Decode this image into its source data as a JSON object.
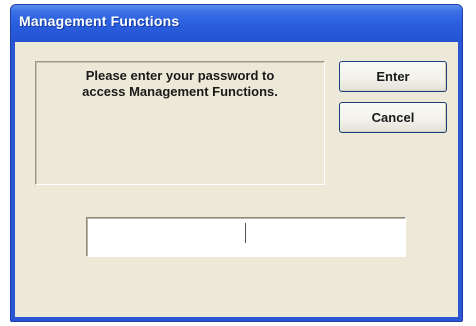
{
  "window": {
    "title": "Management Functions"
  },
  "message": {
    "text": "Please enter your password to\naccess Management Functions."
  },
  "buttons": {
    "enter_label": "Enter",
    "cancel_label": "Cancel"
  },
  "password_input": {
    "value": "",
    "placeholder": ""
  },
  "colors": {
    "titlebar": "#2a5ddd",
    "dialog_background": "#ece9d8",
    "button_border": "#1c3f7a"
  }
}
